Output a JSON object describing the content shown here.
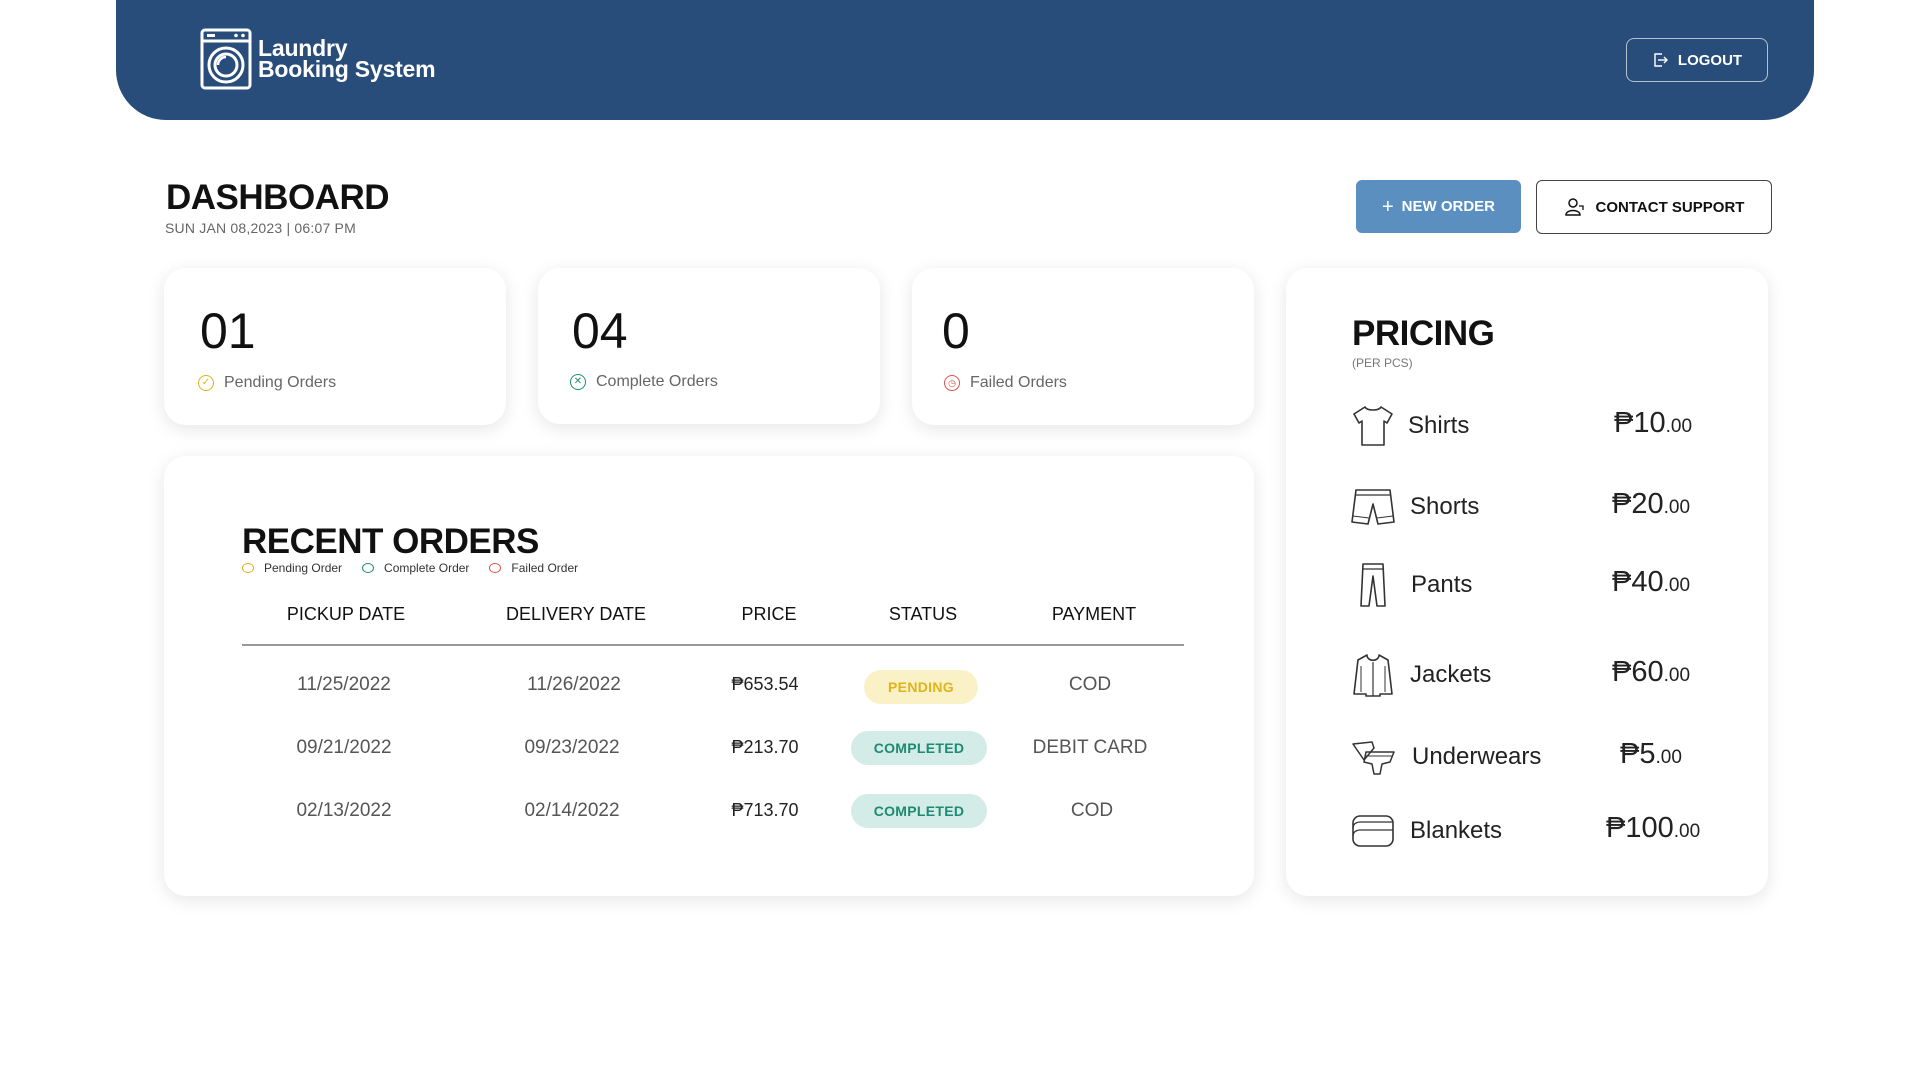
{
  "app": {
    "name_line1": "Laundry",
    "name_line2": "Booking System",
    "logout_label": "LOGOUT"
  },
  "page": {
    "title": "DASHBOARD",
    "datetime": "SUN JAN 08,2023 | 06:07 PM",
    "new_order_label": "NEW ORDER",
    "contact_support_label": "CONTACT SUPPORT"
  },
  "stats": [
    {
      "value": "01",
      "label": "Pending Orders",
      "color": "#e0b319",
      "icon": "check-circle-icon"
    },
    {
      "value": "04",
      "label": "Complete Orders",
      "color": "#1d8a73",
      "icon": "x-circle-icon"
    },
    {
      "value": "0",
      "label": "Failed Orders",
      "color": "#d9534f",
      "icon": "clock-circle-icon"
    }
  ],
  "recent_orders": {
    "title": "RECENT ORDERS",
    "legend": [
      {
        "label": "Pending Order",
        "color": "#e0b319"
      },
      {
        "label": "Complete Order",
        "color": "#1d8a73"
      },
      {
        "label": "Failed Order",
        "color": "#d9534f"
      }
    ],
    "columns": [
      "PICKUP DATE",
      "DELIVERY DATE",
      "PRICE",
      "STATUS",
      "PAYMENT"
    ],
    "rows": [
      {
        "pickup": "11/25/2022",
        "delivery": "11/26/2022",
        "price": "₱653.54",
        "status": "PENDING",
        "payment": "COD"
      },
      {
        "pickup": "09/21/2022",
        "delivery": "09/23/2022",
        "price": "₱213.70",
        "status": "COMPLETED",
        "payment": "DEBIT CARD"
      },
      {
        "pickup": "02/13/2022",
        "delivery": "02/14/2022",
        "price": "₱713.70",
        "status": "COMPLETED",
        "payment": "COD"
      }
    ]
  },
  "pricing": {
    "title": "PRICING",
    "subtitle": "(PER PCS)",
    "items": [
      {
        "name": "Shirts",
        "price": "₱10",
        "cents": ".00",
        "icon": "shirt-icon"
      },
      {
        "name": "Shorts",
        "price": "₱20",
        "cents": ".00",
        "icon": "shorts-icon"
      },
      {
        "name": "Pants",
        "price": "₱40",
        "cents": ".00",
        "icon": "pants-icon"
      },
      {
        "name": "Jackets",
        "price": "₱60",
        "cents": ".00",
        "icon": "jacket-icon"
      },
      {
        "name": "Underwears",
        "price": "₱5",
        "cents": ".00",
        "icon": "underwear-icon"
      },
      {
        "name": "Blankets",
        "price": "₱100",
        "cents": ".00",
        "icon": "blanket-icon"
      }
    ]
  },
  "colors": {
    "header": "#284d7a",
    "primary_button": "#5b8fbf",
    "pending": "#e0b319",
    "completed": "#1d8a73",
    "failed": "#d9534f"
  }
}
